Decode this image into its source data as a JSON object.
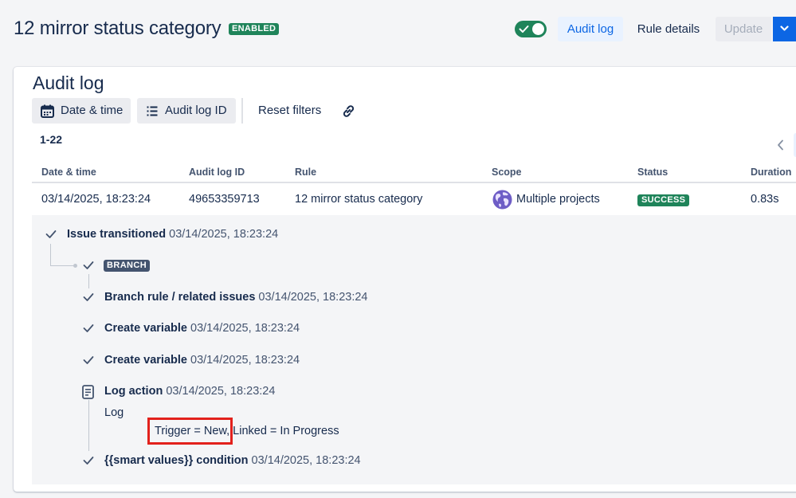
{
  "header": {
    "title": "12 mirror status category",
    "badge": "ENABLED",
    "toggle_on": true,
    "audit_log_button": "Audit log",
    "rule_details_button": "Rule details",
    "update_button": "Update",
    "accent": "#0c66e4",
    "success_color": "#1f845a"
  },
  "audit": {
    "title": "Audit log",
    "filters": {
      "date_time": "Date & time",
      "audit_log_id": "Audit log ID",
      "reset": "Reset filters"
    },
    "range": "1-22",
    "columns": {
      "date_time": "Date & time",
      "audit_log_id": "Audit log ID",
      "rule": "Rule",
      "scope": "Scope",
      "status": "Status",
      "duration": "Duration"
    },
    "row": {
      "date_time": "03/14/2025, 18:23:24",
      "audit_log_id": "49653359713",
      "rule": "12 mirror status category",
      "scope": "Multiple projects",
      "status": "SUCCESS",
      "duration": "0.83s"
    },
    "details": {
      "trigger": {
        "name": "Issue transitioned",
        "time": "03/14/2025, 18:23:24"
      },
      "branch_badge": "BRANCH",
      "steps": [
        {
          "name": "Branch rule / related issues",
          "time": "03/14/2025, 18:23:24",
          "icon": "check-icon"
        },
        {
          "name": "Create variable",
          "time": "03/14/2025, 18:23:24",
          "icon": "check-icon"
        },
        {
          "name": "Create variable",
          "time": "03/14/2025, 18:23:24",
          "icon": "check-icon"
        },
        {
          "name": "Log action",
          "time": "03/14/2025, 18:23:24",
          "icon": "document-icon"
        },
        {
          "name": "{{smart values}} condition",
          "time": "03/14/2025, 18:23:24",
          "icon": "check-icon"
        }
      ],
      "log_label": "Log",
      "log_message": "Trigger = New, Linked = In Progress"
    }
  }
}
